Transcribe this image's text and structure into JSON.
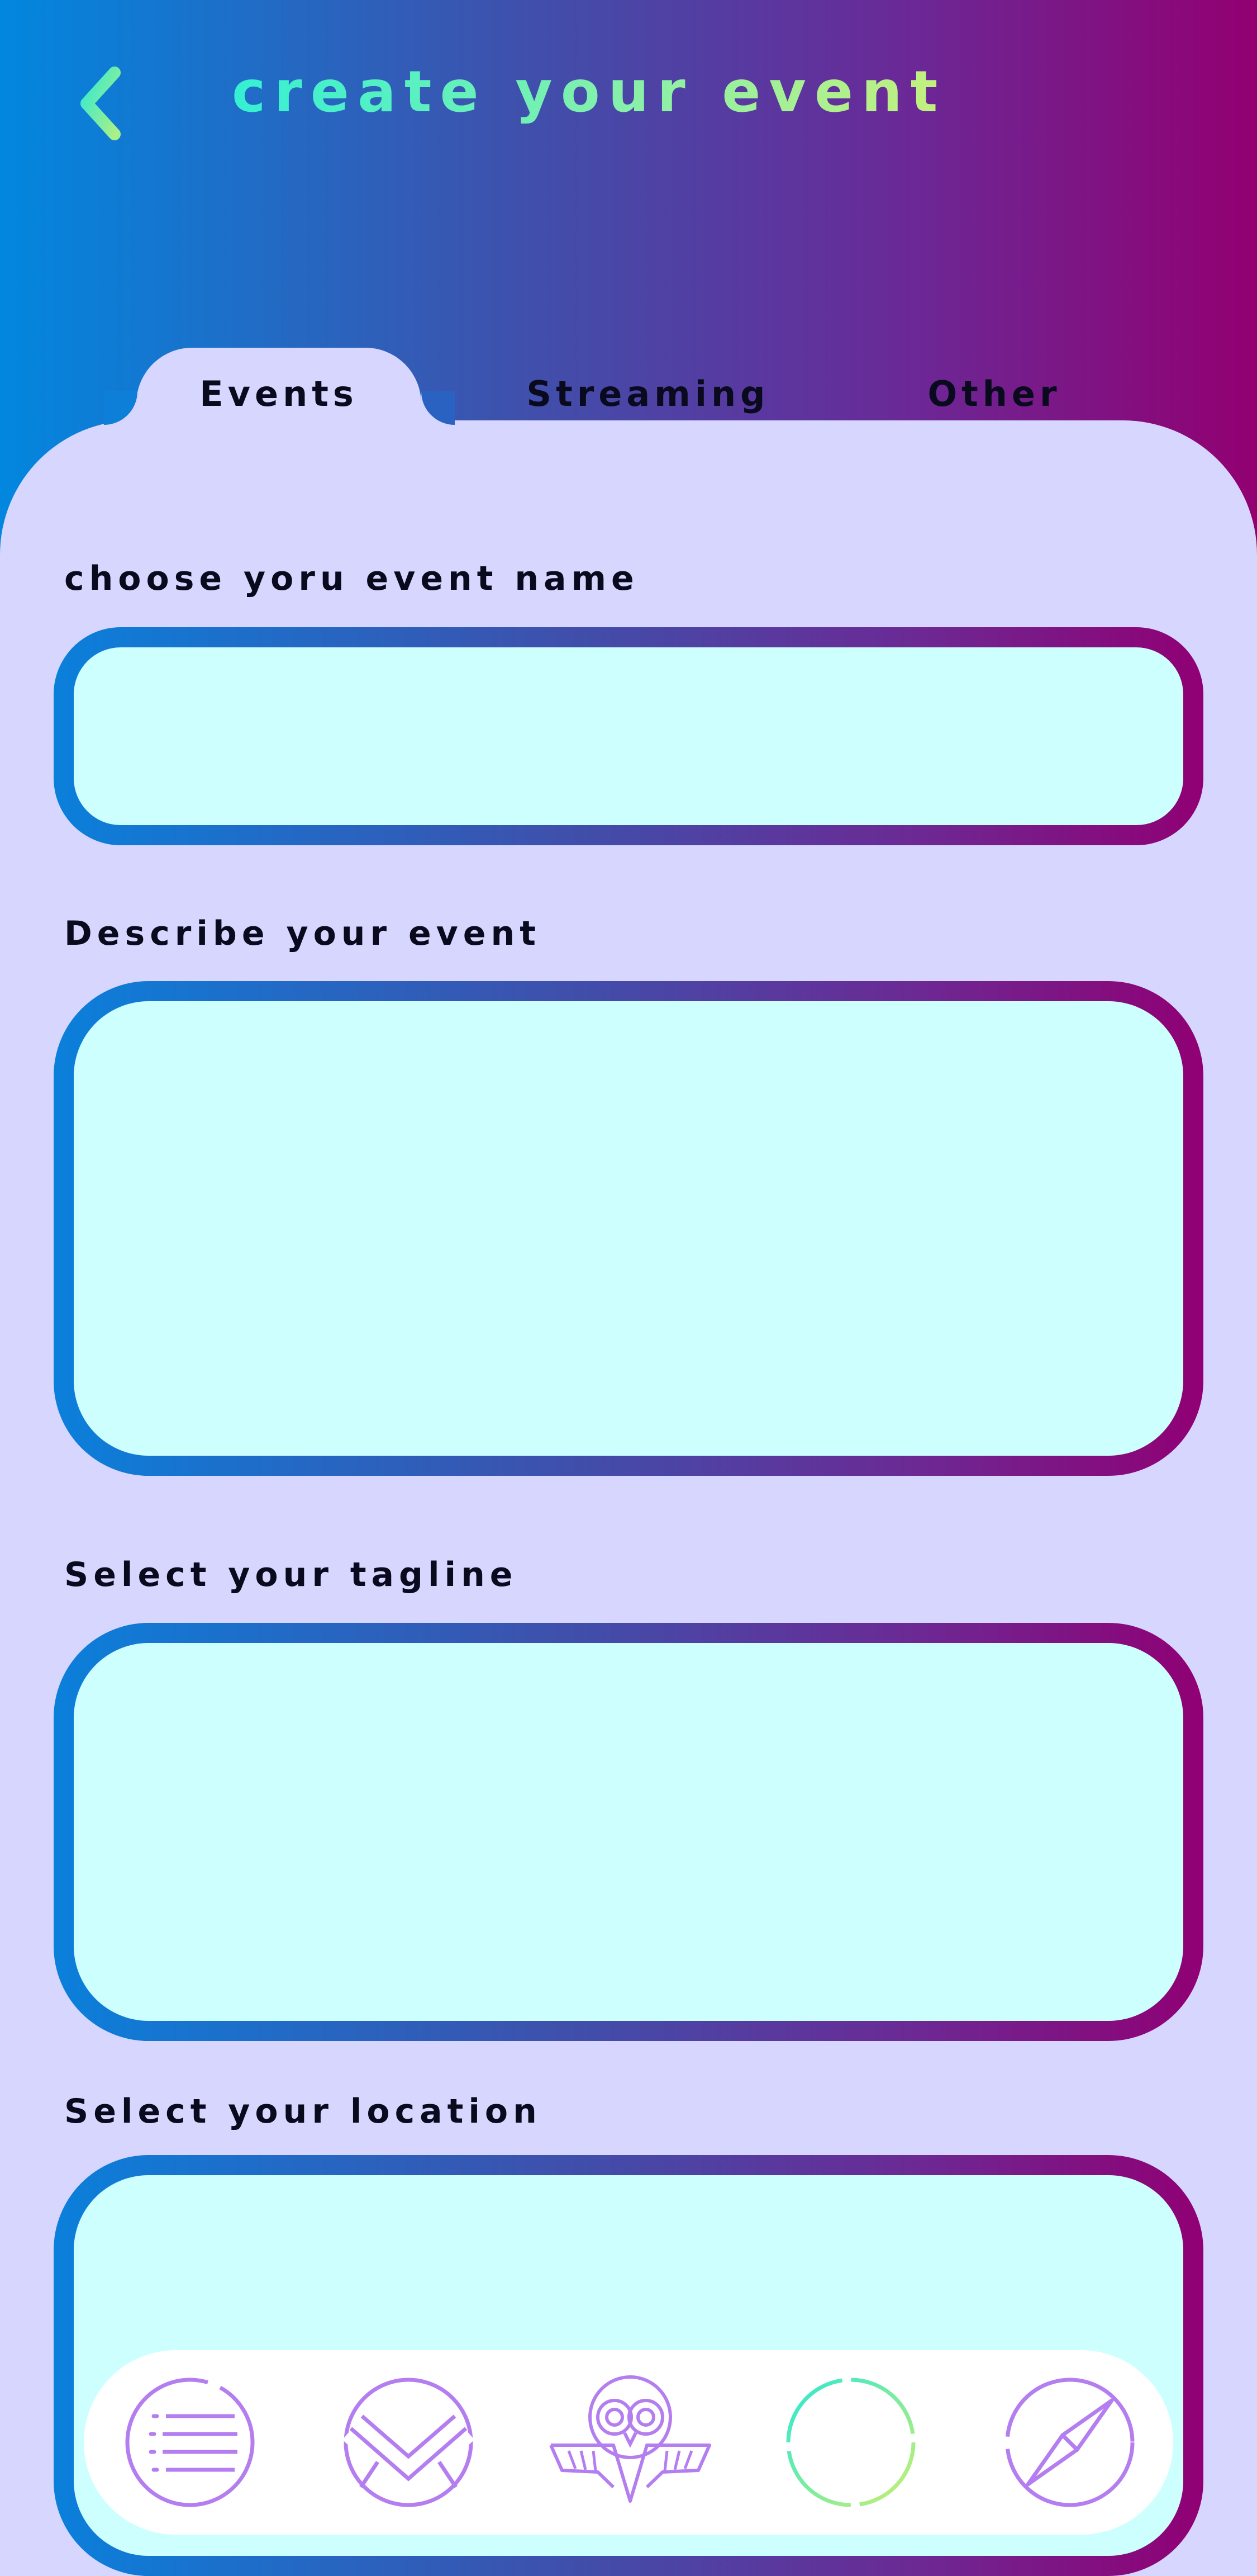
{
  "header": {
    "title": "create your event",
    "back_icon": "chevron-left-icon"
  },
  "tabs": [
    {
      "label": "Events",
      "active": true
    },
    {
      "label": "Streaming",
      "active": false
    },
    {
      "label": "Other",
      "active": false
    }
  ],
  "form": {
    "name_label": "choose yoru event name",
    "name_value": "",
    "description_label": "Describe your event",
    "description_value": "",
    "tagline_label": "Select your tagline",
    "tagline_value": "",
    "location_label": "Select your location",
    "location_value": ""
  },
  "bottom_nav": {
    "items": [
      {
        "icon": "list-icon",
        "active": false
      },
      {
        "icon": "mail-icon",
        "active": false
      },
      {
        "icon": "owl-icon",
        "active": false
      },
      {
        "icon": "crosshair-icon",
        "active": true
      },
      {
        "icon": "compass-icon",
        "active": false
      }
    ]
  },
  "colors": {
    "gradient_start": "#0287df",
    "gradient_end": "#920071",
    "panel_bg": "#d6d6fe",
    "field_bg": "#ceffff",
    "title_gradient": [
      "#35f0d3",
      "#c3f07e"
    ],
    "nav_icon": "#b47ef0"
  }
}
